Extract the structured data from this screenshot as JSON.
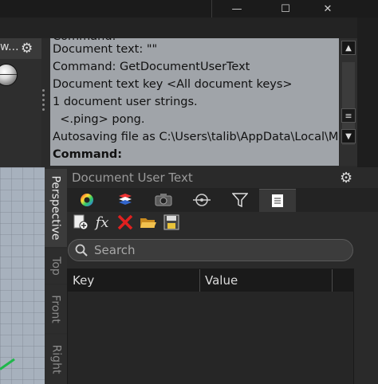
{
  "window": {
    "minimize_glyph": "—",
    "maximize_glyph": "☐",
    "close_glyph": "✕"
  },
  "left_panel": {
    "title": "w...",
    "gear_icon": "gear-icon"
  },
  "command_history": {
    "lines": [
      "Document text: \"\"",
      "Command: GetDocumentUserText",
      "Document text key <All document keys>",
      "1 document user strings.",
      "  <.ping> pong.",
      "Autosaving file as C:\\Users\\talib\\AppData\\Local\\Mc",
      "Command:"
    ]
  },
  "scrollbar": {
    "up_glyph": "▲",
    "down_glyph": "▼",
    "grip_glyph": "≡"
  },
  "viewport_tabs": [
    "Perspective",
    "Top",
    "Front",
    "Right"
  ],
  "panel": {
    "title": "Document User Text",
    "tabs": [
      {
        "icon": "color-wheel-icon"
      },
      {
        "icon": "layers-icon"
      },
      {
        "icon": "camera-icon"
      },
      {
        "icon": "target-icon"
      },
      {
        "icon": "filter-icon"
      },
      {
        "icon": "document-icon",
        "active": true
      }
    ],
    "toolbar": [
      {
        "icon": "new-document-icon"
      },
      {
        "icon": "function-icon",
        "text": "fx"
      },
      {
        "icon": "delete-icon"
      },
      {
        "icon": "open-folder-icon"
      },
      {
        "icon": "save-icon"
      }
    ],
    "search": {
      "placeholder": "Search",
      "value": ""
    },
    "table": {
      "columns": [
        "Key",
        "Value"
      ],
      "rows": []
    }
  },
  "colors": {
    "command_bg": "#a0a4a9",
    "panel_bg": "#2a2a2a",
    "accent_red": "#e0201f"
  }
}
